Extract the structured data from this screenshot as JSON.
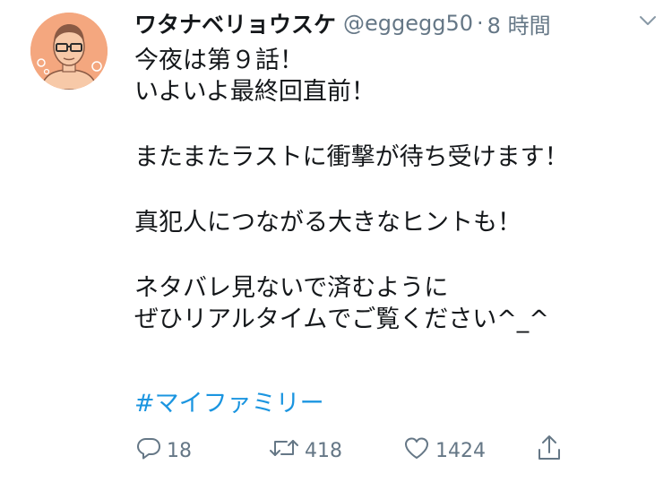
{
  "tweet": {
    "author_name": "ワタナベリョウスケ",
    "handle": "@eggegg50",
    "separator": "·",
    "time": "8 時間",
    "body_paragraphs": [
      [
        "今夜は第９話！",
        "いよいよ最終回直前！"
      ],
      [
        "またまたラストに衝撃が待ち受けます！"
      ],
      [
        "真犯人につながる大きなヒントも！"
      ],
      [
        "ネタバレ見ないで済むように",
        "ぜひリアルタイムでご覧ください^_^"
      ]
    ],
    "hashtag": "#マイファミリー"
  },
  "actions": {
    "reply_count": "18",
    "retweet_count": "418",
    "like_count": "1424"
  },
  "icons": [
    "avatar",
    "chevron-down-icon",
    "reply-icon",
    "retweet-icon",
    "like-icon",
    "share-icon"
  ],
  "colors": {
    "text": "#14171a",
    "secondary": "#657786",
    "link": "#1b95e0",
    "avatar_bg": "#f4a77f"
  }
}
